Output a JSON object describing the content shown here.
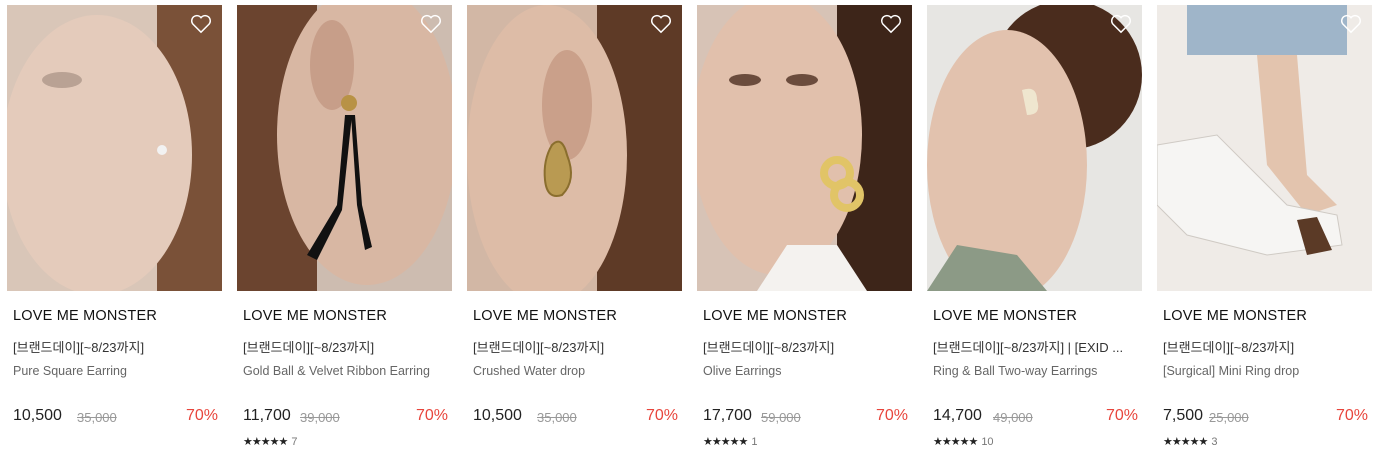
{
  "products": [
    {
      "brand": "LOVE ME MONSTER",
      "promo": "[브랜드데이][~8/23까지]",
      "name": "Pure Square Earring",
      "price": "10,500",
      "original": "35,000",
      "discount": "70%",
      "stars": "",
      "reviews": ""
    },
    {
      "brand": "LOVE ME MONSTER",
      "promo": "[브랜드데이][~8/23까지]",
      "name": "Gold Ball & Velvet Ribbon Earring",
      "price": "11,700",
      "original": "39,000",
      "discount": "70%",
      "stars": "★★★★★",
      "reviews": "7"
    },
    {
      "brand": "LOVE ME MONSTER",
      "promo": "[브랜드데이][~8/23까지]",
      "name": "Crushed Water drop",
      "price": "10,500",
      "original": "35,000",
      "discount": "70%",
      "stars": "",
      "reviews": ""
    },
    {
      "brand": "LOVE ME MONSTER",
      "promo": "[브랜드데이][~8/23까지]",
      "name": "Olive Earrings",
      "price": "17,700",
      "original": "59,000",
      "discount": "70%",
      "stars": "★★★★★",
      "reviews": "1"
    },
    {
      "brand": "LOVE ME MONSTER",
      "promo": "[브랜드데이][~8/23까지] | [EXID ...",
      "name": "Ring & Ball Two-way Earrings",
      "price": "14,700",
      "original": "49,000",
      "discount": "70%",
      "stars": "★★★★★",
      "reviews": "10"
    },
    {
      "brand": "LOVE ME MONSTER",
      "promo": "[브랜드데이][~8/23까지]",
      "name": "[Surgical] Mini Ring drop",
      "price": "7,500",
      "original": "25,000",
      "discount": "70%",
      "stars": "★★★★★",
      "reviews": "3"
    }
  ],
  "icons": {
    "wishlist": "heart-outline-icon",
    "rating": "star-icon"
  },
  "colors": {
    "discount": "#e8453c",
    "original_price": "#999999"
  }
}
